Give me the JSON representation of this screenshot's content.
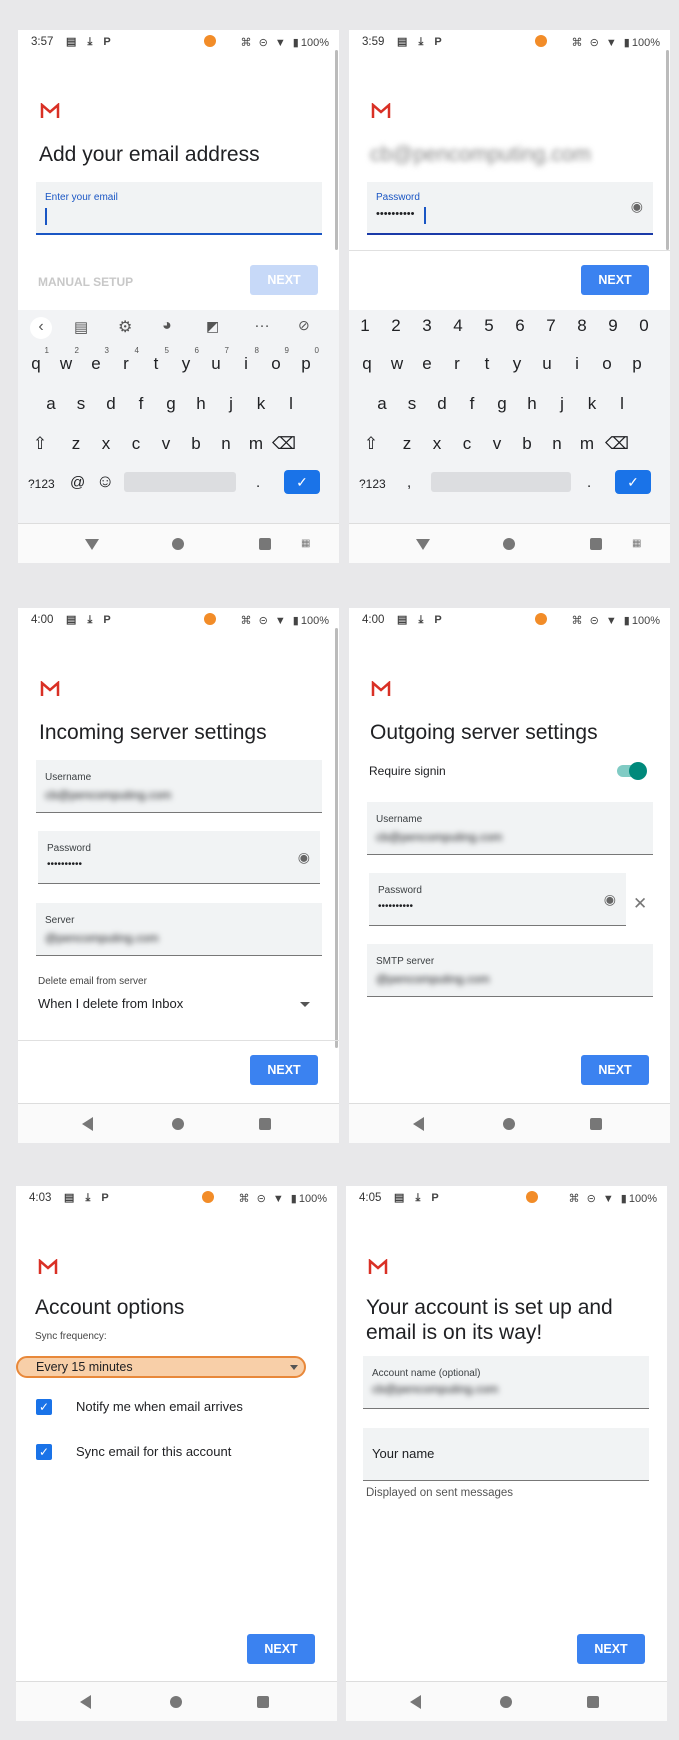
{
  "gmail_logo": "M",
  "phone1": {
    "status": {
      "time": "3:57",
      "battery": "100%"
    },
    "title": "Add your email address",
    "email_field": {
      "label": "Enter your email",
      "value": ""
    },
    "manual_setup": "MANUAL SETUP",
    "next": "NEXT",
    "kb_toolbar": [
      "‹",
      "☷",
      "⚙",
      "☼",
      "▣",
      "…",
      "✕"
    ],
    "row1": [
      "q",
      "w",
      "e",
      "r",
      "t",
      "y",
      "u",
      "i",
      "o",
      "p"
    ],
    "row1_nums": [
      "1",
      "2",
      "3",
      "4",
      "5",
      "6",
      "7",
      "8",
      "9",
      "0"
    ],
    "row2": [
      "a",
      "s",
      "d",
      "f",
      "g",
      "h",
      "j",
      "k",
      "l"
    ],
    "row3": [
      "⇧",
      "z",
      "x",
      "c",
      "v",
      "b",
      "n",
      "m",
      "⌫"
    ],
    "row4": {
      "sym": "?123",
      "at": "@",
      "emoji": "☺",
      "period": ".",
      "enter": "✓"
    }
  },
  "phone2": {
    "status": {
      "time": "3:59",
      "battery": "100%"
    },
    "email": "cb@pencomputing.com",
    "password_field": {
      "label": "Password",
      "value": "••••••••••"
    },
    "next": "NEXT",
    "numrow": [
      "1",
      "2",
      "3",
      "4",
      "5",
      "6",
      "7",
      "8",
      "9",
      "0"
    ],
    "row1": [
      "q",
      "w",
      "e",
      "r",
      "t",
      "y",
      "u",
      "i",
      "o",
      "p"
    ],
    "row2": [
      "a",
      "s",
      "d",
      "f",
      "g",
      "h",
      "j",
      "k",
      "l"
    ],
    "row3": [
      "⇧",
      "z",
      "x",
      "c",
      "v",
      "b",
      "n",
      "m",
      "⌫"
    ],
    "row4": {
      "sym": "?123",
      "comma": ",",
      "period": ".",
      "enter": "✓"
    }
  },
  "phone3": {
    "status": {
      "time": "4:00",
      "battery": "100%"
    },
    "title": "Incoming server settings",
    "username": {
      "label": "Username",
      "value": "cb@pencomputing.com"
    },
    "password": {
      "label": "Password",
      "value": "••••••••••"
    },
    "server": {
      "label": "Server",
      "value": "@pencomputing.com"
    },
    "delete_label": "Delete email from server",
    "delete_value": "When I delete from Inbox",
    "next": "NEXT"
  },
  "phone4": {
    "status": {
      "time": "4:00",
      "battery": "100%"
    },
    "title": "Outgoing server settings",
    "require_signin": "Require signin",
    "username": {
      "label": "Username",
      "value": "cb@pencomputing.com"
    },
    "password": {
      "label": "Password",
      "value": "••••••••••"
    },
    "smtp": {
      "label": "SMTP server",
      "value": "@pencomputing.com"
    },
    "next": "NEXT"
  },
  "phone5": {
    "status": {
      "time": "4:03",
      "battery": "100%"
    },
    "title": "Account options",
    "sync_label": "Sync frequency:",
    "sync_value": "Every 15 minutes",
    "notify": "Notify me when email arrives",
    "sync_email": "Sync email for this account",
    "next": "NEXT"
  },
  "phone6": {
    "status": {
      "time": "4:05",
      "battery": "100%"
    },
    "title_line1": "Your account is set up and",
    "title_line2": "email is on its way!",
    "account_name": {
      "label": "Account name (optional)",
      "value": "cb@pencomputing.com"
    },
    "your_name": "Your name",
    "displayed": "Displayed on sent messages",
    "next": "NEXT"
  },
  "colors": {
    "accent": "#3b82f0",
    "gmail_red": "#d93025",
    "toggle": "#00897b",
    "highlight": "#f8cfa8"
  }
}
